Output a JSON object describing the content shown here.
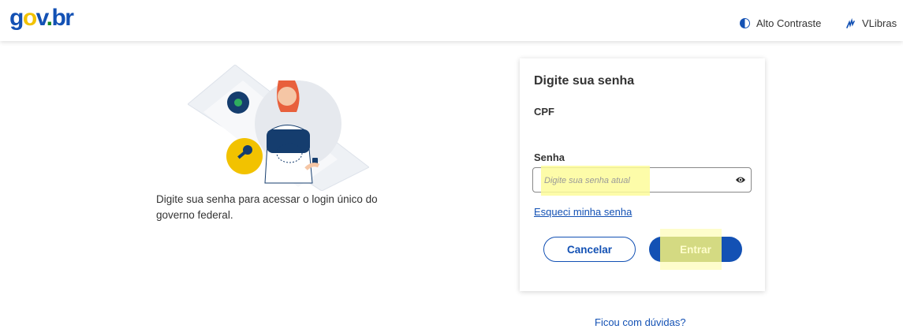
{
  "header": {
    "logo_parts": [
      "g",
      "o",
      "v",
      ".",
      "br"
    ],
    "contrast_label": "Alto Contraste",
    "libras_label": "VLibras"
  },
  "intro_text": "Digite sua senha para acessar o login único do governo federal.",
  "card": {
    "title": "Digite sua senha",
    "cpf_label": "CPF",
    "password_label": "Senha",
    "password_placeholder": "Digite sua senha atual",
    "password_value": "",
    "forgot_link": "Esqueci minha senha",
    "cancel_label": "Cancelar",
    "enter_label": "Entrar"
  },
  "faq_link": "Ficou com dúvidas?",
  "colors": {
    "brand_blue": "#1351b4",
    "highlight_yellow": "#fdfb9a"
  },
  "icons": [
    "contrast-icon",
    "libras-hand-icon",
    "eye-icon",
    "key-icon"
  ]
}
